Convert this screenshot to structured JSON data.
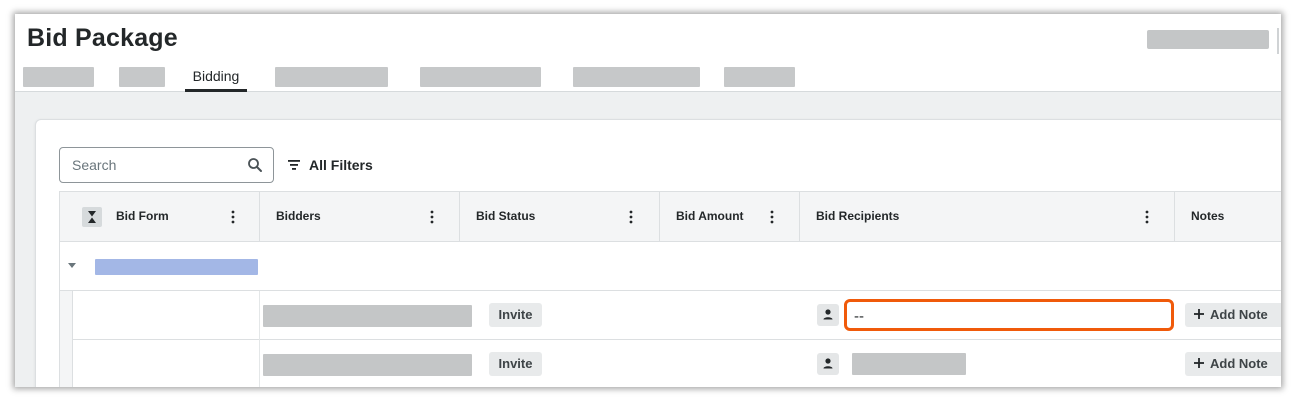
{
  "header": {
    "title": "Bid Package",
    "tabs": [
      {
        "label": ""
      },
      {
        "label": ""
      },
      {
        "label": "Bidding",
        "active": true
      },
      {
        "label": ""
      },
      {
        "label": ""
      },
      {
        "label": ""
      },
      {
        "label": ""
      }
    ]
  },
  "toolbar": {
    "search_placeholder": "Search",
    "search_value": "",
    "filters_label": "All Filters"
  },
  "table": {
    "columns": [
      {
        "label": "Bid Form"
      },
      {
        "label": "Bidders"
      },
      {
        "label": "Bid Status"
      },
      {
        "label": "Bid Amount"
      },
      {
        "label": "Bid Recipients"
      },
      {
        "label": "Notes"
      }
    ],
    "group_label": "",
    "rows": [
      {
        "bidder": "",
        "status": "Invite",
        "recipients": "--",
        "notes_action": "Add Note",
        "recipients_highlighted": true
      },
      {
        "bidder": "",
        "status": "Invite",
        "recipients": "",
        "notes_action": "Add Note",
        "recipients_highlighted": false
      }
    ]
  },
  "colors": {
    "highlight": "#f05a0a",
    "group_placeholder": "#a3b7e6",
    "placeholder_gray": "#c4c6c7"
  }
}
